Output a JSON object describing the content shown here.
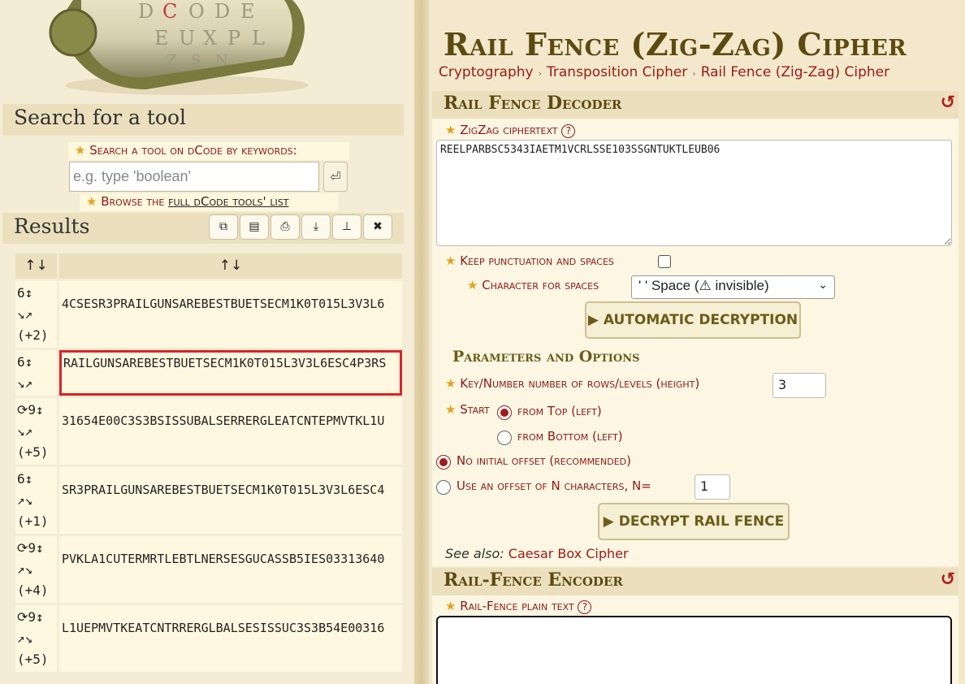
{
  "search": {
    "heading": "Search for a tool",
    "label": "Search a tool on dCode by keywords:",
    "placeholder": "e.g. type 'boolean'",
    "go_icon": "enter-icon",
    "browse_prefix": "Browse the ",
    "browse_link": "full dCode tools' list"
  },
  "results": {
    "heading": "Results",
    "tools": [
      "copy-icon",
      "copy-all-icon",
      "print-icon",
      "download-icon",
      "pin-icon",
      "close-icon"
    ],
    "col1": "↑↓",
    "col2": "↑↓",
    "rows": [
      {
        "key": [
          "6↕",
          "↘↗",
          "(+2)"
        ],
        "value": "4CSESR3PRAILGUNSAREBESTBUETSECM1K0T015L3V3L6"
      },
      {
        "key": [
          "6↕",
          "↘↗"
        ],
        "value": "RAILGUNSAREBESTBUETSECM1K0T015L3V3L6ESC4P3RS",
        "highlighted": true
      },
      {
        "key": [
          "⟳9↕",
          "↘↗",
          "(+5)"
        ],
        "value": "31654E00C3S3BSISSUBALSERRERGLEATCNTEPMVTKL1U"
      },
      {
        "key": [
          "6↕",
          "↗↘",
          "(+1)"
        ],
        "value": "SR3PRAILGUNSAREBESTBUETSECM1K0T015L3V3L6ESC4"
      },
      {
        "key": [
          "⟳9↕",
          "↗↘",
          "(+4)"
        ],
        "value": "PVKLA1CUTERMRTLEBTLNERSESGUCASSB5IES03313640"
      },
      {
        "key": [
          "⟳9↕",
          "↗↘",
          "(+5)"
        ],
        "value": "L1UEPMVTKEATCNTRRERGLBALSESISSUC3S3B54E00316"
      }
    ]
  },
  "page": {
    "title": "Rail Fence (Zig-Zag) Cipher",
    "breadcrumbs": [
      "Cryptography",
      "Transposition Cipher",
      "Rail Fence (Zig-Zag) Cipher"
    ]
  },
  "decoder": {
    "heading": "Rail Fence Decoder",
    "ciphertext_label": "ZigZag ciphertext",
    "ciphertext": "REELPARBSC5343IAETM1VCRLSSE103SSGNTUKTLEUB06",
    "keep_punct_label": "Keep punctuation and spaces",
    "space_char_label": "Character for spaces",
    "space_char_value": "' ' Space (⚠ invisible)",
    "auto_button": "▶ AUTOMATIC DECRYPTION",
    "params_title": "Parameters and Options",
    "key_label": "Key/Number number of rows/levels (height)",
    "key_value": "3",
    "start_label": "Start",
    "from_top": "from Top (left)",
    "from_bottom": "from Bottom (left)",
    "no_offset": "No initial offset (recommended)",
    "use_offset": "Use an offset of N characters, N=",
    "offset_value": "1",
    "decrypt_button": "▶ DECRYPT RAIL FENCE",
    "see_also_label": "See also:",
    "see_also_link": "Caesar Box Cipher"
  },
  "encoder": {
    "heading": "Rail-Fence Encoder",
    "plaintext_label": "Rail-Fence plain text"
  },
  "colors": {
    "accent_red": "#8b1a1a",
    "title_brown": "#5c4a10",
    "highlight_border": "#d9232a"
  }
}
